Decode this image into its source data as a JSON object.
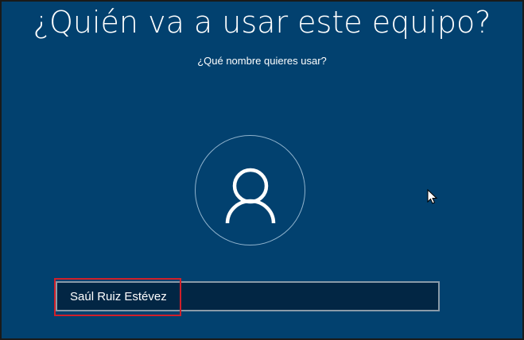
{
  "setup": {
    "title": "¿Quién va a usar este equipo?",
    "subtitle": "¿Qué nombre quieres usar?"
  },
  "avatar": {
    "icon": "user-icon"
  },
  "name_field": {
    "value": "Saúl Ruiz Estévez"
  },
  "colors": {
    "background": "#02416f",
    "input_background": "#022644",
    "highlight": "#d0202a"
  }
}
